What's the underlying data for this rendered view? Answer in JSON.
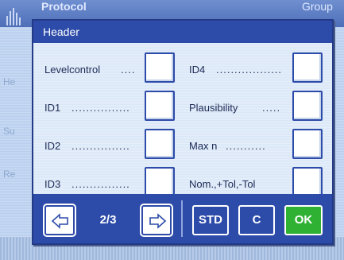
{
  "background": {
    "app_title": "Protocol",
    "app_title_right": "Group",
    "rows": [
      "He",
      "Su",
      "Re"
    ]
  },
  "dialog": {
    "title": "Header",
    "left_items": [
      {
        "label": "Levelcontrol",
        "dots": "....",
        "checked": false
      },
      {
        "label": "ID1",
        "dots": "................",
        "checked": false
      },
      {
        "label": "ID2",
        "dots": "................",
        "checked": false
      },
      {
        "label": "ID3",
        "dots": "................",
        "checked": false
      }
    ],
    "right_items": [
      {
        "label": "ID4",
        "dots": "..................",
        "checked": false
      },
      {
        "label": "Plausibility",
        "dots": ".....",
        "checked": false
      },
      {
        "label": "Max n",
        "dots": "...........",
        "checked": false
      },
      {
        "label": "Nom.,+Tol,-Tol",
        "dots": "",
        "checked": false
      }
    ],
    "footer": {
      "page_indicator": "2/3",
      "std_label": "STD",
      "c_label": "C",
      "ok_label": "OK"
    }
  },
  "colors": {
    "accent": "#2d4ba9",
    "ok": "#2fb134"
  }
}
